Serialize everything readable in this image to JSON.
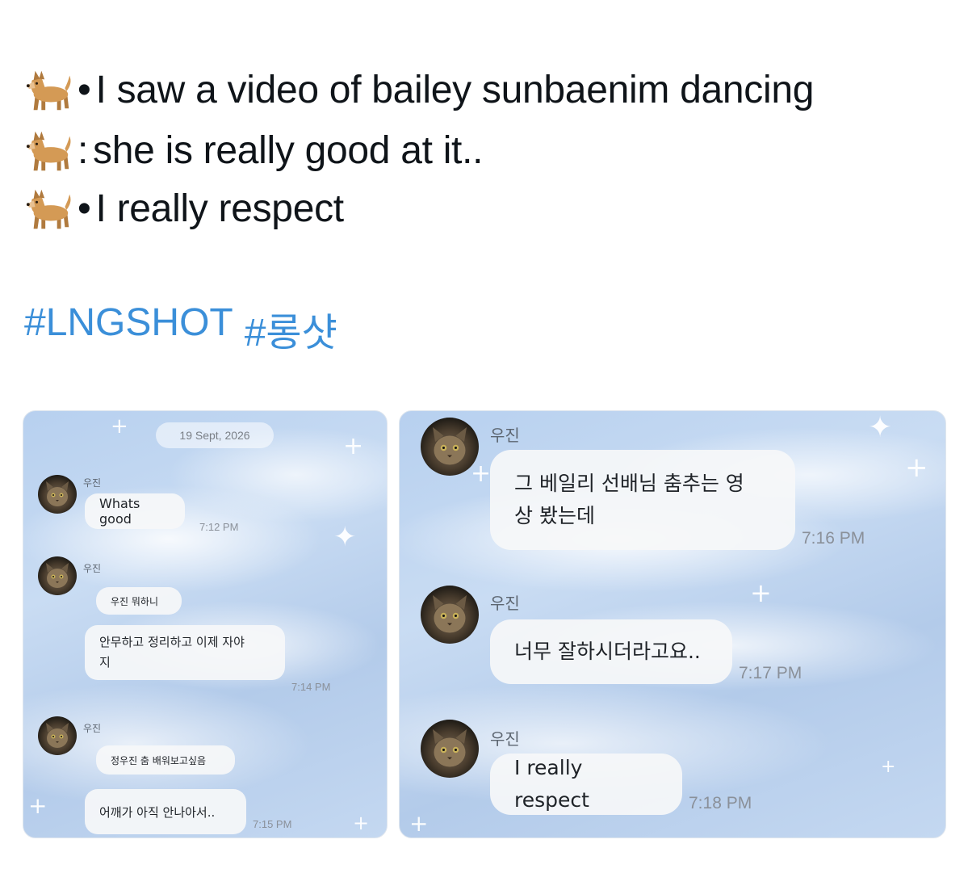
{
  "tweet": {
    "lines": [
      {
        "icon": "dog-emoji",
        "separator": "•",
        "text": "I saw a video of bailey sunbaenim dancing"
      },
      {
        "icon": "dog-emoji",
        "separator": ":",
        "text": "she is really good at it.."
      },
      {
        "icon": "dog-emoji",
        "separator": "•",
        "text": "I really respect"
      }
    ],
    "hashtags": [
      "#LNGSHOT",
      "#롱샷"
    ]
  },
  "screenshot_left": {
    "date": "19 Sept, 2026",
    "groups": [
      {
        "sender": "우진",
        "messages": [
          "Whats good"
        ],
        "time": "7:12 PM"
      },
      {
        "sender": "우진",
        "messages": [
          "우진 뭐하니",
          "안무하고 정리하고 이제 자야\n지"
        ],
        "time": "7:14 PM"
      },
      {
        "sender": "우진",
        "messages": [
          "정우진 춤 배워보고싶음",
          "어깨가 아직 안나아서.."
        ],
        "time": "7:15 PM"
      }
    ]
  },
  "screenshot_right": {
    "groups": [
      {
        "sender": "우진",
        "messages": [
          "그 베일리 선배님 춤추는 영\n상 봤는데"
        ],
        "time": "7:16 PM"
      },
      {
        "sender": "우진",
        "messages": [
          "너무 잘하시더라고요.."
        ],
        "time": "7:17 PM"
      },
      {
        "sender": "우진",
        "messages": [
          "I really respect"
        ],
        "time": "7:18 PM"
      }
    ]
  },
  "colors": {
    "hashtag": "#3b8fd9",
    "text": "#0f1419",
    "bubble": "#f6f7f9",
    "sky": "#b7d0ef",
    "timestamp": "#8a9099"
  }
}
